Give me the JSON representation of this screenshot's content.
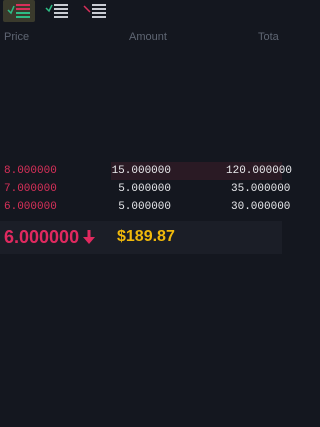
{
  "toolbar": {
    "views": [
      {
        "name": "both-sides",
        "icon": "orderbook-both-icon",
        "active": true
      },
      {
        "name": "buy-side",
        "icon": "orderbook-bids-icon",
        "active": false
      },
      {
        "name": "sell-side",
        "icon": "orderbook-asks-icon",
        "active": false
      }
    ]
  },
  "header": {
    "price": "Price",
    "amount": "Amount",
    "total": "Tota"
  },
  "asks": [
    {
      "price": "8.000000",
      "amount": "15.000000",
      "total": "120.000000",
      "depth": 1.0
    },
    {
      "price": "7.000000",
      "amount": "5.000000",
      "total": "35.000000",
      "depth": 0.0
    },
    {
      "price": "6.000000",
      "amount": "5.000000",
      "total": "30.000000",
      "depth": 0.0
    }
  ],
  "ticker": {
    "last_price": "6.000000",
    "direction_icon": "arrow-down-icon",
    "usd_price": "$189.87"
  },
  "colors": {
    "ask": "#d9305a",
    "last_price": "#e0295f",
    "usd_price": "#f0b90b",
    "background": "#14171f"
  }
}
